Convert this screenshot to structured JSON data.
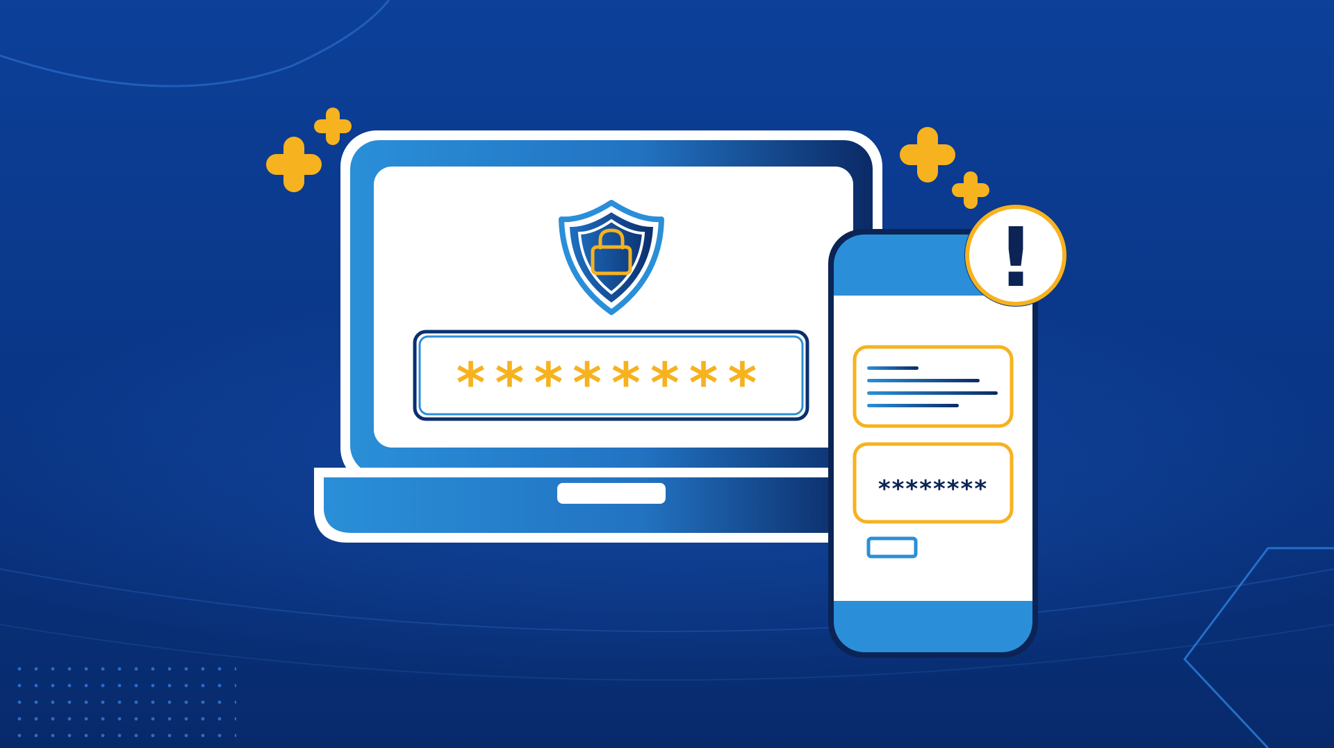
{
  "laptop": {
    "password_mask": "********"
  },
  "phone": {
    "password_mask": "********",
    "alert_symbol": "!"
  },
  "colors": {
    "background_top": "#0b3f97",
    "background_bottom": "#072a6b",
    "device_blue": "#2a8fd8",
    "device_dark": "#0b2f6e",
    "white": "#ffffff",
    "accent_yellow": "#f6b21f",
    "navy": "#0b2455"
  },
  "icons": [
    "shield-lock-icon",
    "sparkle-plus-icon",
    "alert-icon"
  ]
}
